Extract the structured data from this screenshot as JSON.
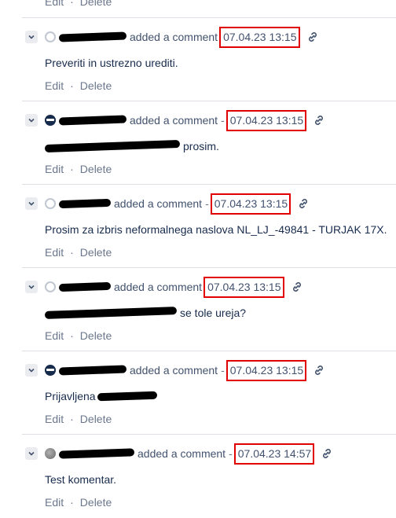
{
  "top_actions": {
    "edit": "Edit",
    "separator": "·",
    "delete": "Delete"
  },
  "comments": [
    {
      "action": "added a comment",
      "dash": "-",
      "timestamp": "07.04.23 13:15",
      "text": "Preveriti in ustrezno urediti.",
      "edit": "Edit",
      "separator": "·",
      "delete": "Delete"
    },
    {
      "action": "added a comment",
      "dash": "-",
      "timestamp": "07.04.23 13:15",
      "text": "prosim.",
      "edit": "Edit",
      "separator": "·",
      "delete": "Delete"
    },
    {
      "action": "added a comment",
      "dash": "-",
      "timestamp": "07.04.23 13:15",
      "text": "Prosim za izbris neformalnega naslova NL_LJ_-49841 - TURJAK 17X.",
      "edit": "Edit",
      "separator": "·",
      "delete": "Delete"
    },
    {
      "action": "added a comment",
      "dash": "-",
      "timestamp": "07.04.23 13:15",
      "text": "se tole ureja?",
      "edit": "Edit",
      "separator": "·",
      "delete": "Delete"
    },
    {
      "action": "added a comment",
      "dash": "-",
      "timestamp": "07.04.23 13:15",
      "text": "Prijavljena",
      "edit": "Edit",
      "separator": "·",
      "delete": "Delete"
    },
    {
      "action": "added a comment",
      "dash": "-",
      "timestamp": "07.04.23 14:57",
      "text": "Test komentar.",
      "edit": "Edit",
      "separator": "·",
      "delete": "Delete"
    }
  ],
  "icons": {
    "collapse": "chevron-down-icon",
    "permalink": "link-icon",
    "avatar": "avatar-icon"
  },
  "colors": {
    "highlight": "#e00000",
    "link": "#0052cc",
    "muted": "#6b778c",
    "divider": "#dcdfe4"
  }
}
